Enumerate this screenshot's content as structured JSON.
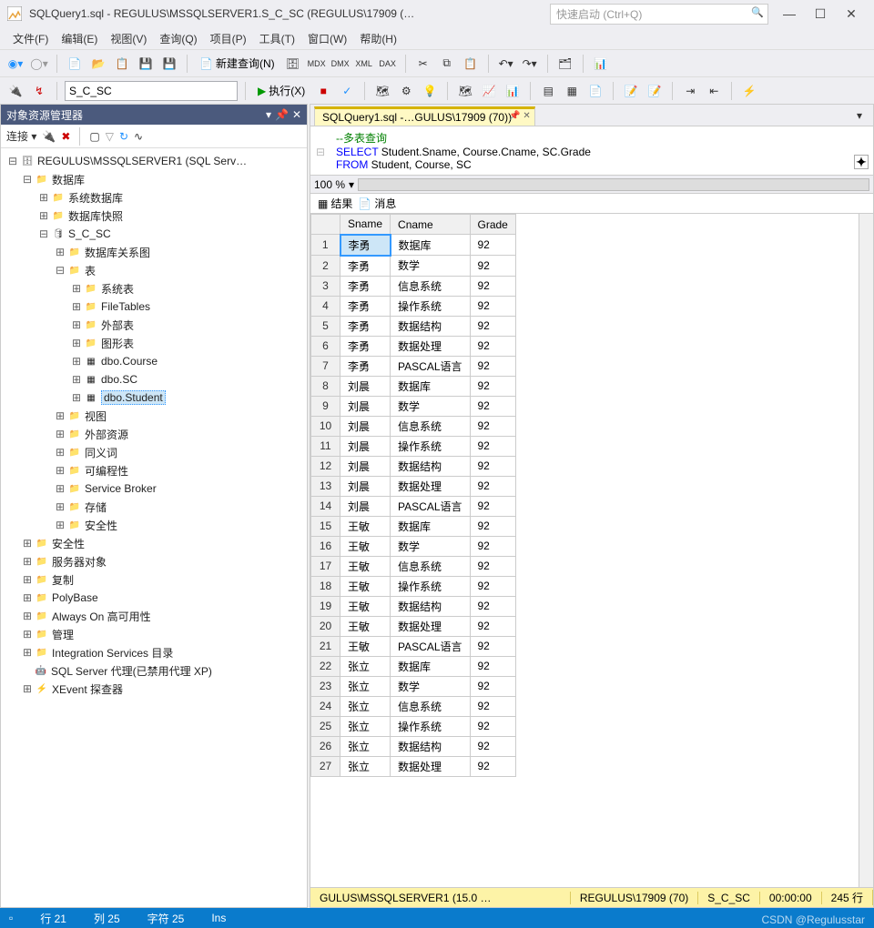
{
  "title": "SQLQuery1.sql - REGULUS\\MSSQLSERVER1.S_C_SC (REGULUS\\17909 (…",
  "quick_launch_placeholder": "快速启动 (Ctrl+Q)",
  "menu": [
    "文件(F)",
    "编辑(E)",
    "视图(V)",
    "查询(Q)",
    "项目(P)",
    "工具(T)",
    "窗口(W)",
    "帮助(H)"
  ],
  "toolbar1": {
    "new_query": "新建查询(N)"
  },
  "toolbar2": {
    "db_selected": "S_C_SC",
    "execute": "执行(X)"
  },
  "explorer": {
    "title": "对象资源管理器",
    "connect": "连接",
    "root": "REGULUS\\MSSQLSERVER1 (SQL Serv…",
    "nodes": {
      "databases": "数据库",
      "sys_db": "系统数据库",
      "db_snap": "数据库快照",
      "db_name": "S_C_SC",
      "db_diagram": "数据库关系图",
      "tables": "表",
      "sys_tables": "系统表",
      "filetables": "FileTables",
      "ext_tables": "外部表",
      "graph_tables": "图形表",
      "t1": "dbo.Course",
      "t2": "dbo.SC",
      "t3": "dbo.Student",
      "views": "视图",
      "ext_res": "外部资源",
      "synonyms": "同义词",
      "programmability": "可编程性",
      "service_broker": "Service Broker",
      "storage": "存储",
      "db_security": "安全性",
      "security": "安全性",
      "server_objs": "服务器对象",
      "replication": "复制",
      "polybase": "PolyBase",
      "alwayson": "Always On 高可用性",
      "management": "管理",
      "is_catalog": "Integration Services 目录",
      "sql_agent": "SQL Server 代理(已禁用代理 XP)",
      "xevent": "XEvent 探查器"
    }
  },
  "doc_tab": "SQLQuery1.sql -…GULUS\\17909 (70))*",
  "editor": {
    "comment": "--多表查询",
    "line1": {
      "select": "SELECT",
      "cols": " Student.Sname, Course.Cname, SC.Grade"
    },
    "line2": {
      "from": "FROM",
      "tables": " Student, Course, SC"
    }
  },
  "zoom": "100 %",
  "result_tabs": {
    "results": "结果",
    "messages": "消息"
  },
  "grid": {
    "headers": [
      "Sname",
      "Cname",
      "Grade"
    ],
    "rows": [
      [
        "李勇",
        "数据库",
        "92"
      ],
      [
        "李勇",
        "数学",
        "92"
      ],
      [
        "李勇",
        "信息系统",
        "92"
      ],
      [
        "李勇",
        "操作系统",
        "92"
      ],
      [
        "李勇",
        "数据结构",
        "92"
      ],
      [
        "李勇",
        "数据处理",
        "92"
      ],
      [
        "李勇",
        "PASCAL语言",
        "92"
      ],
      [
        "刘晨",
        "数据库",
        "92"
      ],
      [
        "刘晨",
        "数学",
        "92"
      ],
      [
        "刘晨",
        "信息系统",
        "92"
      ],
      [
        "刘晨",
        "操作系统",
        "92"
      ],
      [
        "刘晨",
        "数据结构",
        "92"
      ],
      [
        "刘晨",
        "数据处理",
        "92"
      ],
      [
        "刘晨",
        "PASCAL语言",
        "92"
      ],
      [
        "王敏",
        "数据库",
        "92"
      ],
      [
        "王敏",
        "数学",
        "92"
      ],
      [
        "王敏",
        "信息系统",
        "92"
      ],
      [
        "王敏",
        "操作系统",
        "92"
      ],
      [
        "王敏",
        "数据结构",
        "92"
      ],
      [
        "王敏",
        "数据处理",
        "92"
      ],
      [
        "王敏",
        "PASCAL语言",
        "92"
      ],
      [
        "张立",
        "数据库",
        "92"
      ],
      [
        "张立",
        "数学",
        "92"
      ],
      [
        "张立",
        "信息系统",
        "92"
      ],
      [
        "张立",
        "操作系统",
        "92"
      ],
      [
        "张立",
        "数据结构",
        "92"
      ],
      [
        "张立",
        "数据处理",
        "92"
      ]
    ]
  },
  "status": {
    "conn": "GULUS\\MSSQLSERVER1 (15.0 …",
    "user": "REGULUS\\17909 (70)",
    "db": "S_C_SC",
    "time": "00:00:00",
    "rows": "245 行"
  },
  "bottom": {
    "line": "行 21",
    "col": "列 25",
    "char": "字符 25",
    "mode": "Ins"
  },
  "watermark": "CSDN @Regulusstar"
}
